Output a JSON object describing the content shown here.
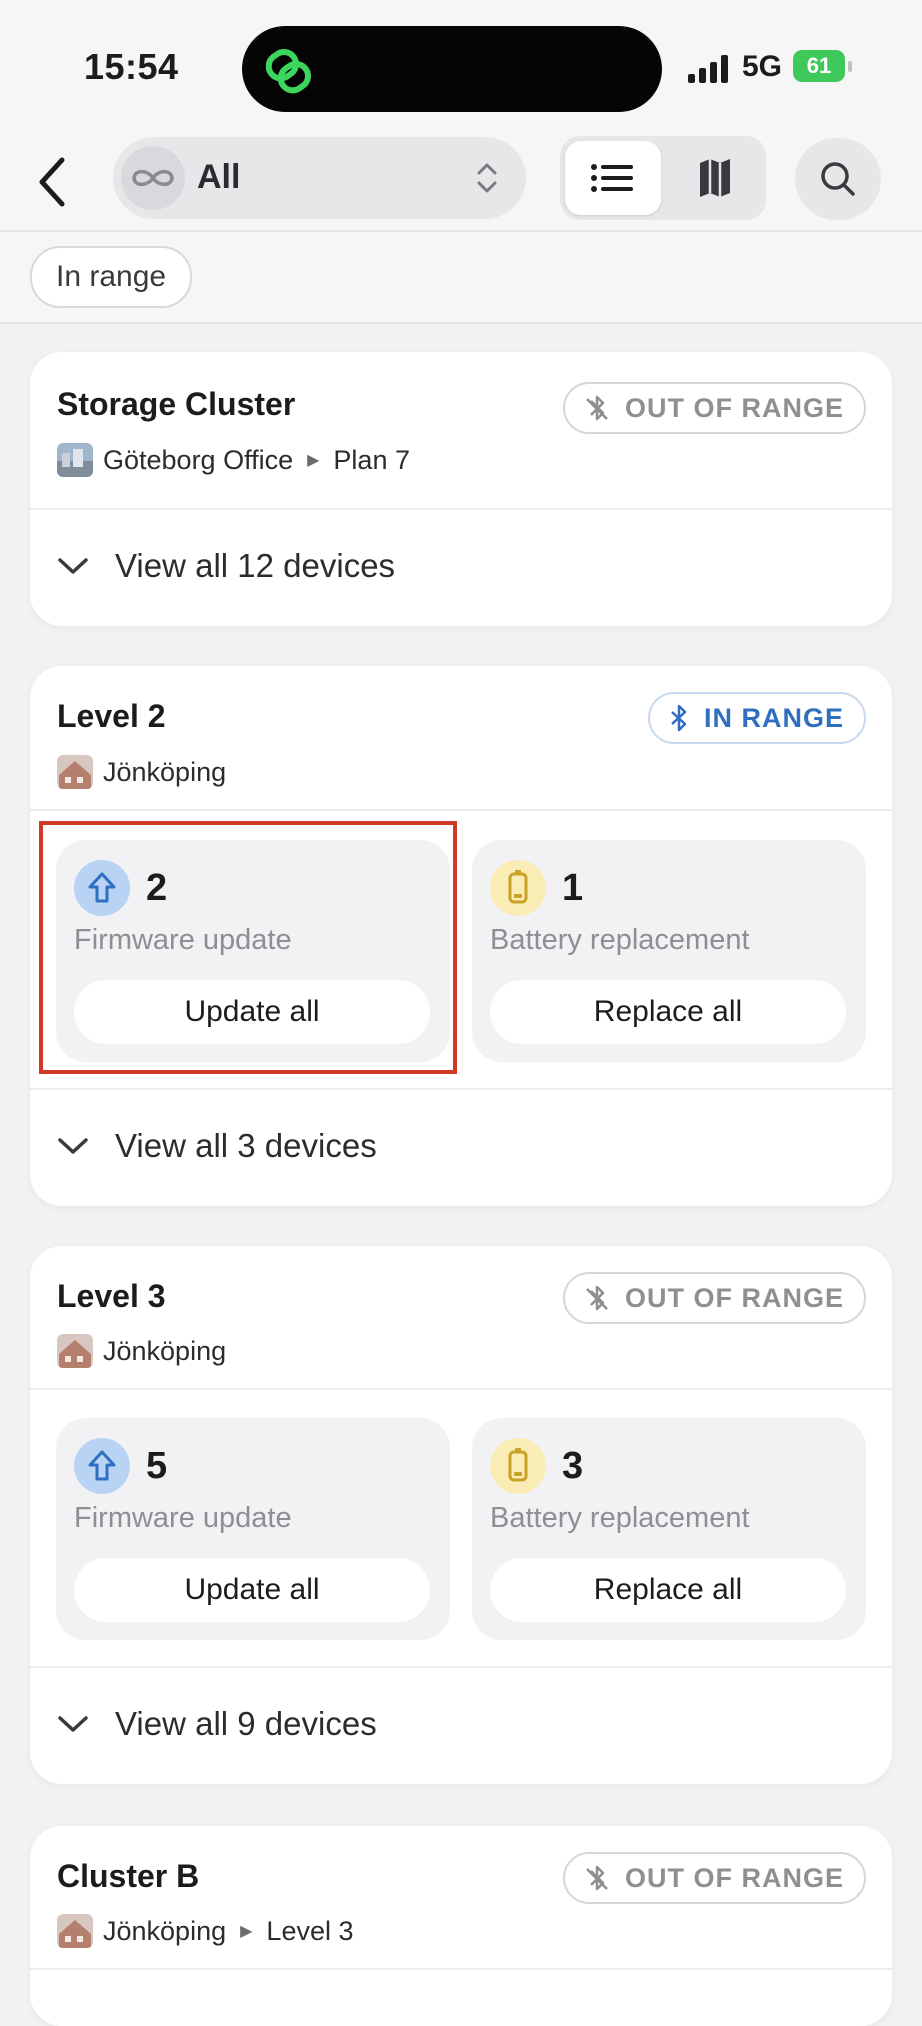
{
  "status_bar": {
    "time": "15:54",
    "network": "5G",
    "battery": "61"
  },
  "nav": {
    "scope_label": "All"
  },
  "filter": {
    "chip_label": "In range"
  },
  "cards": [
    {
      "title": "Storage Cluster",
      "range": "OUT OF RANGE",
      "location": "Göteborg Office",
      "sublocation": "Plan 7",
      "view_all": "View all 12 devices"
    },
    {
      "title": "Level 2",
      "range": "IN RANGE",
      "location": "Jönköping",
      "firmware": {
        "count": "2",
        "label": "Firmware update",
        "button": "Update all"
      },
      "battery": {
        "count": "1",
        "label": "Battery replacement",
        "button": "Replace all"
      },
      "view_all": "View all 3 devices"
    },
    {
      "title": "Level 3",
      "range": "OUT OF RANGE",
      "location": "Jönköping",
      "firmware": {
        "count": "5",
        "label": "Firmware update",
        "button": "Update all"
      },
      "battery": {
        "count": "3",
        "label": "Battery replacement",
        "button": "Replace all"
      },
      "view_all": "View all 9 devices"
    },
    {
      "title": "Cluster B",
      "range": "OUT OF RANGE",
      "location": "Jönköping",
      "sublocation": "Level 3"
    }
  ],
  "colors": {
    "accent_blue": "#2f6fc0",
    "battery_green": "#3fc95a",
    "highlight_red": "#d03a26",
    "firmware_icon_bg": "#b9d3f5",
    "battery_icon_bg": "#f9ecb4"
  },
  "icons": {
    "island": "link-icon",
    "back": "chevron-left-icon",
    "scope": "infinity-icon",
    "scope_toggle": "chevron-up-down-icon",
    "list": "list-icon",
    "map": "map-icon",
    "search": "search-icon",
    "out_of_range": "bluetooth-off-icon",
    "in_range": "bluetooth-icon",
    "firmware": "arrow-up-icon",
    "battery": "battery-icon",
    "expand": "chevron-down-icon"
  }
}
